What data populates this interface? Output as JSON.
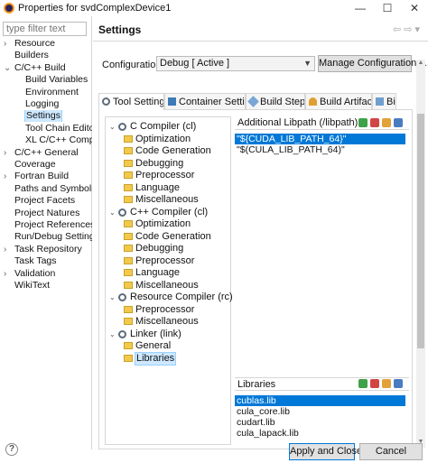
{
  "window": {
    "title": "Properties for svdComplexDevice1",
    "min": "—",
    "max": "☐",
    "close": "✕"
  },
  "filter": {
    "placeholder": "type filter text"
  },
  "nav": [
    {
      "label": "Resource",
      "twisty": "›",
      "indent": 0
    },
    {
      "label": "Builders",
      "twisty": "",
      "indent": 0
    },
    {
      "label": "C/C++ Build",
      "twisty": "⌄",
      "indent": 0
    },
    {
      "label": "Build Variables",
      "twisty": "",
      "indent": 1
    },
    {
      "label": "Environment",
      "twisty": "",
      "indent": 1
    },
    {
      "label": "Logging",
      "twisty": "",
      "indent": 1
    },
    {
      "label": "Settings",
      "twisty": "",
      "indent": 1,
      "selected": true
    },
    {
      "label": "Tool Chain Editor",
      "twisty": "",
      "indent": 1
    },
    {
      "label": "XL C/C++ Compiler",
      "twisty": "",
      "indent": 1
    },
    {
      "label": "C/C++ General",
      "twisty": "›",
      "indent": 0
    },
    {
      "label": "Coverage",
      "twisty": "",
      "indent": 0
    },
    {
      "label": "Fortran Build",
      "twisty": "›",
      "indent": 0
    },
    {
      "label": "Paths and Symbols",
      "twisty": "",
      "indent": 0
    },
    {
      "label": "Project Facets",
      "twisty": "",
      "indent": 0
    },
    {
      "label": "Project Natures",
      "twisty": "",
      "indent": 0
    },
    {
      "label": "Project References",
      "twisty": "",
      "indent": 0
    },
    {
      "label": "Run/Debug Settings",
      "twisty": "",
      "indent": 0
    },
    {
      "label": "Task Repository",
      "twisty": "›",
      "indent": 0
    },
    {
      "label": "Task Tags",
      "twisty": "",
      "indent": 0
    },
    {
      "label": "Validation",
      "twisty": "›",
      "indent": 0
    },
    {
      "label": "WikiText",
      "twisty": "",
      "indent": 0
    }
  ],
  "page": {
    "title": "Settings",
    "back": "⇦",
    "fwd": "⇨",
    "menu": "▾"
  },
  "configuration": {
    "label": "Configuration:",
    "value": "Debug  [ Active ]",
    "manage": "Manage Configurations..."
  },
  "tabs": [
    "Tool Settings",
    "Container Settings",
    "Build Steps",
    "Build Artifact",
    "Binary Parsers"
  ],
  "tree": [
    {
      "label": "C Compiler (cl)",
      "kind": "top",
      "ex": "⌄"
    },
    {
      "label": "Optimization",
      "kind": "child"
    },
    {
      "label": "Code Generation",
      "kind": "child"
    },
    {
      "label": "Debugging",
      "kind": "child"
    },
    {
      "label": "Preprocessor",
      "kind": "child"
    },
    {
      "label": "Language",
      "kind": "child"
    },
    {
      "label": "Miscellaneous",
      "kind": "child"
    },
    {
      "label": "C++ Compiler (cl)",
      "kind": "top",
      "ex": "⌄"
    },
    {
      "label": "Optimization",
      "kind": "child"
    },
    {
      "label": "Code Generation",
      "kind": "child"
    },
    {
      "label": "Debugging",
      "kind": "child"
    },
    {
      "label": "Preprocessor",
      "kind": "child"
    },
    {
      "label": "Language",
      "kind": "child"
    },
    {
      "label": "Miscellaneous",
      "kind": "child"
    },
    {
      "label": "Resource Compiler (rc)",
      "kind": "top",
      "ex": "⌄"
    },
    {
      "label": "Preprocessor",
      "kind": "child"
    },
    {
      "label": "Miscellaneous",
      "kind": "child"
    },
    {
      "label": "Linker (link)",
      "kind": "top",
      "ex": "⌄"
    },
    {
      "label": "General",
      "kind": "child"
    },
    {
      "label": "Libraries",
      "kind": "child",
      "selected": true
    }
  ],
  "libpath": {
    "header": "Additional Libpath (/libpath)",
    "items": [
      "\"${CUDA_LIB_PATH_64}\"",
      "\"$(CULA_LIB_PATH_64)\""
    ],
    "selected": 0
  },
  "libraries": {
    "header": "Libraries",
    "items": [
      "cublas.lib",
      "cula_core.lib",
      "cudart.lib",
      "cula_lapack.lib"
    ],
    "selected": 0
  },
  "buttons": {
    "help": "?",
    "apply_close": "Apply and Close",
    "cancel": "Cancel"
  },
  "colors": {
    "selection": "#0078d7",
    "tree_selection": "#cde8ff",
    "folder": "#f2c94c"
  }
}
